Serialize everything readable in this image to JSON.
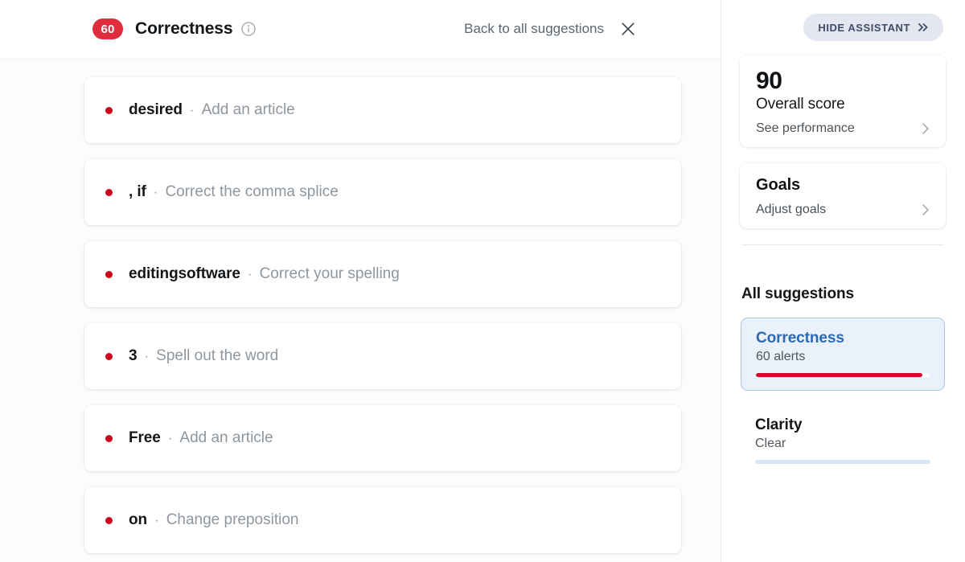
{
  "header": {
    "badge_count": "60",
    "category_title": "Correctness",
    "info_icon": "info-icon",
    "back_link": "Back to all suggestions",
    "close_icon": "close-icon"
  },
  "suggestions": [
    {
      "term": "desired",
      "separator": "·",
      "action": "Add an article"
    },
    {
      "term": ", if",
      "separator": "·",
      "action": "Correct the comma splice"
    },
    {
      "term": "editingsoftware",
      "separator": "·",
      "action": "Correct your spelling"
    },
    {
      "term": "3",
      "separator": "·",
      "action": "Spell out the word"
    },
    {
      "term": "Free",
      "separator": "·",
      "action": "Add an article"
    },
    {
      "term": "on",
      "separator": "·",
      "action": "Change preposition"
    }
  ],
  "sidebar": {
    "hide_assistant": {
      "label": "HIDE ASSISTANT",
      "icon": "chevron-double-right-icon"
    },
    "score_card": {
      "value": "90",
      "label": "Overall score",
      "link": "See performance",
      "chevron_icon": "chevron-right-icon"
    },
    "goals_card": {
      "title": "Goals",
      "link": "Adjust goals",
      "chevron_icon": "chevron-right-icon"
    },
    "all_suggestions_title": "All suggestions",
    "categories": [
      {
        "name": "Correctness",
        "subtitle": "60 alerts",
        "selected": true,
        "bar_percent": 96,
        "bar_color": "#c8102e"
      },
      {
        "name": "Clarity",
        "subtitle": "Clear",
        "selected": false,
        "bar_percent": 100,
        "bar_color": "#d7e6f5"
      }
    ]
  },
  "colors": {
    "badge_red": "#e02d3c",
    "dot_red": "#d0021b",
    "accent_blue": "#2a6ab5",
    "selected_bg": "#e9f1fa",
    "selected_border": "#a8c8e8"
  }
}
